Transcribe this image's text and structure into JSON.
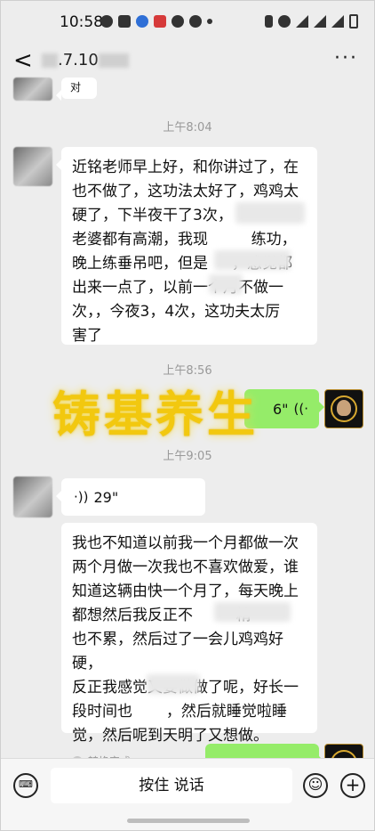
{
  "status_bar": {
    "time": "10:58"
  },
  "nav": {
    "back_label": "<",
    "title": ".7.10",
    "more_label": "···"
  },
  "messages": {
    "prev_fragment": "对",
    "ts1": "上午8:04",
    "msg1": "近铭老师早上好，和你讲过了，在\n也不做了，这功法太好了，鸡鸡太\n硬了，下半夜干了3次，\n老婆都有高潮，我现         练功，\n晚上练垂吊吧，但是     ，感觉都\n出来一点了，以前一个月不做一\n次，，今夜3，4次，这功夫太厉\n害了",
    "ts2": "上午8:56",
    "voice_out": "6\"",
    "ts3": "上午9:05",
    "voice_in": "29\"",
    "msg2": "我也不知道以前我一个月都做一次\n两个月做一次我也不喜欢做爱，谁\n知道这辆由快一个月了，每天晚上\n都想然后我反正不         精\n也不累，然后过了一会儿鸡鸡好硬，\n反正我感觉又要做做了呢，好长一\n段时间也       ，然后就睡觉啦睡\n觉，然后呢到天明了又想做。",
    "convert_label": "转换完成"
  },
  "watermark": "铸基养生",
  "input_bar": {
    "hold_to_talk": "按住 说话"
  }
}
